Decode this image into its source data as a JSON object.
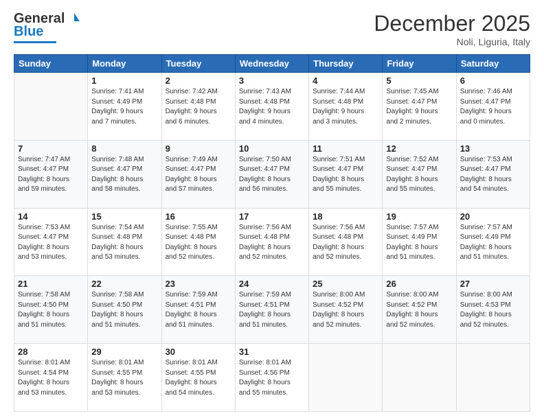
{
  "header": {
    "logo_line1": "General",
    "logo_line2": "Blue",
    "title": "December 2025",
    "subtitle": "Noli, Liguria, Italy"
  },
  "days_of_week": [
    "Sunday",
    "Monday",
    "Tuesday",
    "Wednesday",
    "Thursday",
    "Friday",
    "Saturday"
  ],
  "weeks": [
    [
      {
        "day": "",
        "info": ""
      },
      {
        "day": "1",
        "info": "Sunrise: 7:41 AM\nSunset: 4:49 PM\nDaylight: 9 hours\nand 7 minutes."
      },
      {
        "day": "2",
        "info": "Sunrise: 7:42 AM\nSunset: 4:48 PM\nDaylight: 9 hours\nand 6 minutes."
      },
      {
        "day": "3",
        "info": "Sunrise: 7:43 AM\nSunset: 4:48 PM\nDaylight: 9 hours\nand 4 minutes."
      },
      {
        "day": "4",
        "info": "Sunrise: 7:44 AM\nSunset: 4:48 PM\nDaylight: 9 hours\nand 3 minutes."
      },
      {
        "day": "5",
        "info": "Sunrise: 7:45 AM\nSunset: 4:47 PM\nDaylight: 9 hours\nand 2 minutes."
      },
      {
        "day": "6",
        "info": "Sunrise: 7:46 AM\nSunset: 4:47 PM\nDaylight: 9 hours\nand 0 minutes."
      }
    ],
    [
      {
        "day": "7",
        "info": "Sunrise: 7:47 AM\nSunset: 4:47 PM\nDaylight: 8 hours\nand 59 minutes."
      },
      {
        "day": "8",
        "info": "Sunrise: 7:48 AM\nSunset: 4:47 PM\nDaylight: 8 hours\nand 58 minutes."
      },
      {
        "day": "9",
        "info": "Sunrise: 7:49 AM\nSunset: 4:47 PM\nDaylight: 8 hours\nand 57 minutes."
      },
      {
        "day": "10",
        "info": "Sunrise: 7:50 AM\nSunset: 4:47 PM\nDaylight: 8 hours\nand 56 minutes."
      },
      {
        "day": "11",
        "info": "Sunrise: 7:51 AM\nSunset: 4:47 PM\nDaylight: 8 hours\nand 55 minutes."
      },
      {
        "day": "12",
        "info": "Sunrise: 7:52 AM\nSunset: 4:47 PM\nDaylight: 8 hours\nand 55 minutes."
      },
      {
        "day": "13",
        "info": "Sunrise: 7:53 AM\nSunset: 4:47 PM\nDaylight: 8 hours\nand 54 minutes."
      }
    ],
    [
      {
        "day": "14",
        "info": "Sunrise: 7:53 AM\nSunset: 4:47 PM\nDaylight: 8 hours\nand 53 minutes."
      },
      {
        "day": "15",
        "info": "Sunrise: 7:54 AM\nSunset: 4:48 PM\nDaylight: 8 hours\nand 53 minutes."
      },
      {
        "day": "16",
        "info": "Sunrise: 7:55 AM\nSunset: 4:48 PM\nDaylight: 8 hours\nand 52 minutes."
      },
      {
        "day": "17",
        "info": "Sunrise: 7:56 AM\nSunset: 4:48 PM\nDaylight: 8 hours\nand 52 minutes."
      },
      {
        "day": "18",
        "info": "Sunrise: 7:56 AM\nSunset: 4:48 PM\nDaylight: 8 hours\nand 52 minutes."
      },
      {
        "day": "19",
        "info": "Sunrise: 7:57 AM\nSunset: 4:49 PM\nDaylight: 8 hours\nand 51 minutes."
      },
      {
        "day": "20",
        "info": "Sunrise: 7:57 AM\nSunset: 4:49 PM\nDaylight: 8 hours\nand 51 minutes."
      }
    ],
    [
      {
        "day": "21",
        "info": "Sunrise: 7:58 AM\nSunset: 4:50 PM\nDaylight: 8 hours\nand 51 minutes."
      },
      {
        "day": "22",
        "info": "Sunrise: 7:58 AM\nSunset: 4:50 PM\nDaylight: 8 hours\nand 51 minutes."
      },
      {
        "day": "23",
        "info": "Sunrise: 7:59 AM\nSunset: 4:51 PM\nDaylight: 8 hours\nand 51 minutes."
      },
      {
        "day": "24",
        "info": "Sunrise: 7:59 AM\nSunset: 4:51 PM\nDaylight: 8 hours\nand 51 minutes."
      },
      {
        "day": "25",
        "info": "Sunrise: 8:00 AM\nSunset: 4:52 PM\nDaylight: 8 hours\nand 52 minutes."
      },
      {
        "day": "26",
        "info": "Sunrise: 8:00 AM\nSunset: 4:52 PM\nDaylight: 8 hours\nand 52 minutes."
      },
      {
        "day": "27",
        "info": "Sunrise: 8:00 AM\nSunset: 4:53 PM\nDaylight: 8 hours\nand 52 minutes."
      }
    ],
    [
      {
        "day": "28",
        "info": "Sunrise: 8:01 AM\nSunset: 4:54 PM\nDaylight: 8 hours\nand 53 minutes."
      },
      {
        "day": "29",
        "info": "Sunrise: 8:01 AM\nSunset: 4:55 PM\nDaylight: 8 hours\nand 53 minutes."
      },
      {
        "day": "30",
        "info": "Sunrise: 8:01 AM\nSunset: 4:55 PM\nDaylight: 8 hours\nand 54 minutes."
      },
      {
        "day": "31",
        "info": "Sunrise: 8:01 AM\nSunset: 4:56 PM\nDaylight: 8 hours\nand 55 minutes."
      },
      {
        "day": "",
        "info": ""
      },
      {
        "day": "",
        "info": ""
      },
      {
        "day": "",
        "info": ""
      }
    ]
  ]
}
